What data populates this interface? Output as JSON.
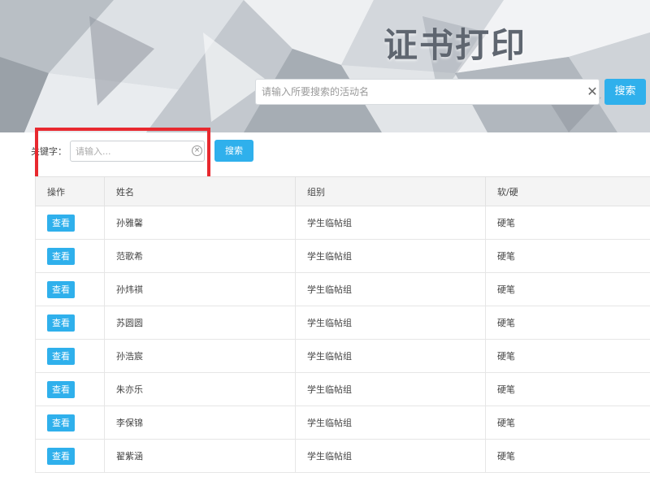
{
  "header": {
    "title": "证书打印",
    "search_placeholder": "请输入所要搜索的活动名",
    "clear_glyph": "✕",
    "search_label": "搜索"
  },
  "filter": {
    "keyword_label": "关键字：",
    "keyword_placeholder": "请输入...",
    "clear_glyph": "×",
    "search_label": "搜索"
  },
  "table": {
    "columns": [
      "操作",
      "姓名",
      "组别",
      "软/硬"
    ],
    "action_label": "查看",
    "rows": [
      {
        "name": "孙雅馨",
        "group": "学生临帖组",
        "type": "硬笔"
      },
      {
        "name": "范歌希",
        "group": "学生临帖组",
        "type": "硬笔"
      },
      {
        "name": "孙炜祺",
        "group": "学生临帖组",
        "type": "硬笔"
      },
      {
        "name": "苏圆圆",
        "group": "学生临帖组",
        "type": "硬笔"
      },
      {
        "name": "孙浩宸",
        "group": "学生临帖组",
        "type": "硬笔"
      },
      {
        "name": "朱亦乐",
        "group": "学生临帖组",
        "type": "硬笔"
      },
      {
        "name": "李保锦",
        "group": "学生临帖组",
        "type": "硬笔"
      },
      {
        "name": "翟紫涵",
        "group": "学生临帖组",
        "type": "硬笔"
      }
    ]
  },
  "colors": {
    "accent": "#2fb0ec",
    "highlight_frame": "#e8292f",
    "title": "#5f6670"
  }
}
